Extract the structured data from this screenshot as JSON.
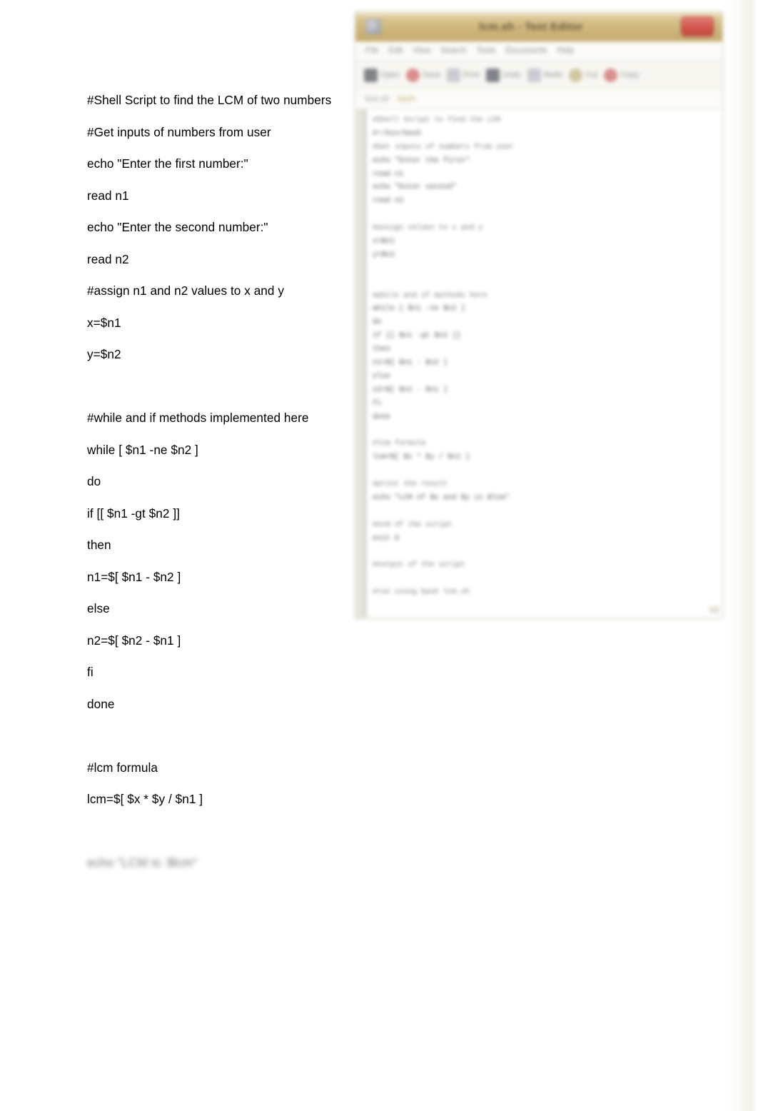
{
  "document": {
    "type": "text-document-page",
    "background_color": "#ffffff",
    "script_lines": [
      {
        "text": "#Shell Script to find the LCM of two numbers",
        "kind": "comment"
      },
      {
        "text": "#Get inputs of numbers from user",
        "kind": "comment"
      },
      {
        "text": "echo \"Enter the first number:\"",
        "kind": "code"
      },
      {
        "text": "read n1",
        "kind": "code"
      },
      {
        "text": "echo \"Enter the second number:\"",
        "kind": "code"
      },
      {
        "text": "read n2",
        "kind": "code"
      },
      {
        "text": "#assign n1 and n2 values to x and y",
        "kind": "comment"
      },
      {
        "text": "x=$n1",
        "kind": "code"
      },
      {
        "text": "y=$n2",
        "kind": "code"
      },
      {
        "text": "",
        "kind": "blank"
      },
      {
        "text": "#while and if methods implemented here",
        "kind": "comment"
      },
      {
        "text": "while [ $n1 -ne $n2 ]",
        "kind": "code"
      },
      {
        "text": "do",
        "kind": "code"
      },
      {
        "text": "if [[ $n1 -gt $n2 ]]",
        "kind": "code"
      },
      {
        "text": "then",
        "kind": "code"
      },
      {
        "text": "n1=$[ $n1 - $n2 ]",
        "kind": "code"
      },
      {
        "text": "else",
        "kind": "code"
      },
      {
        "text": "n2=$[ $n2 - $n1 ]",
        "kind": "code"
      },
      {
        "text": "fi",
        "kind": "code"
      },
      {
        "text": "done",
        "kind": "code"
      },
      {
        "text": "",
        "kind": "blank"
      },
      {
        "text": "#lcm formula",
        "kind": "comment"
      },
      {
        "text": "lcm=$[ $x * $y / $n1 ]",
        "kind": "code"
      },
      {
        "text": "",
        "kind": "blank"
      },
      {
        "text": "echo \"LCM is: $lcm\"",
        "kind": "blurred"
      }
    ]
  },
  "editor_screenshot": {
    "note": "embedded out-of-focus screenshot of a text editor window",
    "titlebar": {
      "title": "lcm.sh  -  Text Editor",
      "gradient_top": "#efe7d2",
      "gradient_bottom": "#c3a96c",
      "menu_icon": "app-menu-icon",
      "close_label": ""
    },
    "menubar": [
      "File",
      "Edit",
      "View",
      "Search",
      "Tools",
      "Documents",
      "Help"
    ],
    "toolbar": [
      {
        "icon": "open-icon",
        "label": "Open",
        "tone": "dark"
      },
      {
        "icon": "save-icon",
        "label": "Save",
        "tone": "accent"
      },
      {
        "icon": "print-icon",
        "label": "Print",
        "tone": "pale"
      },
      {
        "icon": "undo-icon",
        "label": "Undo",
        "tone": "dark"
      },
      {
        "icon": "redo-icon",
        "label": "Redo",
        "tone": "pale"
      },
      {
        "icon": "cut-icon",
        "label": "Cut",
        "tone": "warm"
      },
      {
        "icon": "copy-icon",
        "label": "Copy",
        "tone": "accent"
      }
    ],
    "tabstrip": [
      {
        "label": "lcm.sh",
        "highlight": false
      },
      {
        "label": "bash",
        "highlight": true
      }
    ],
    "code_lines": [
      {
        "text": "#Shell Script to find the LCM",
        "kind": "cmt"
      },
      {
        "text": "#!/bin/bash",
        "kind": "code"
      },
      {
        "text": "#Get inputs of numbers from user",
        "kind": "cmt"
      },
      {
        "text": "echo \"Enter the first\"",
        "kind": "code"
      },
      {
        "text": "read n1",
        "kind": "code"
      },
      {
        "text": "echo \"Enter second\"",
        "kind": "code"
      },
      {
        "text": "read n2",
        "kind": "code"
      },
      {
        "text": "",
        "kind": "blank"
      },
      {
        "text": "#assign values to x and y",
        "kind": "cmt"
      },
      {
        "text": "x=$n1",
        "kind": "code"
      },
      {
        "text": "y=$n2",
        "kind": "code"
      },
      {
        "text": "",
        "kind": "blank"
      },
      {
        "text": "",
        "kind": "blank"
      },
      {
        "text": "#while and if methods here",
        "kind": "cmt"
      },
      {
        "text": "while [ $n1 -ne $n2 ]",
        "kind": "code"
      },
      {
        "text": "do",
        "kind": "code"
      },
      {
        "text": "if [[ $n1 -gt $n2 ]]",
        "kind": "code"
      },
      {
        "text": "then",
        "kind": "code"
      },
      {
        "text": "n1=$[ $n1 - $n2 ]",
        "kind": "code"
      },
      {
        "text": "else",
        "kind": "code"
      },
      {
        "text": "n2=$[ $n2 - $n1 ]",
        "kind": "code"
      },
      {
        "text": "fi",
        "kind": "code"
      },
      {
        "text": "done",
        "kind": "code"
      },
      {
        "text": "",
        "kind": "blank"
      },
      {
        "text": "#lcm formula",
        "kind": "cmt"
      },
      {
        "text": "lcm=$[ $x * $y / $n1 ]",
        "kind": "code"
      },
      {
        "text": "",
        "kind": "blank"
      },
      {
        "text": "#print the result",
        "kind": "cmt"
      },
      {
        "text": "echo \"LCM of $x and $y is $lcm\"",
        "kind": "code"
      },
      {
        "text": "",
        "kind": "blank"
      },
      {
        "text": "#end of the script",
        "kind": "cmt"
      },
      {
        "text": "exit 0",
        "kind": "code"
      },
      {
        "text": "",
        "kind": "blank"
      },
      {
        "text": "#output of the script",
        "kind": "cmt"
      },
      {
        "text": "",
        "kind": "blank"
      },
      {
        "text": "#run using bash lcm.sh",
        "kind": "cmt"
      }
    ]
  }
}
